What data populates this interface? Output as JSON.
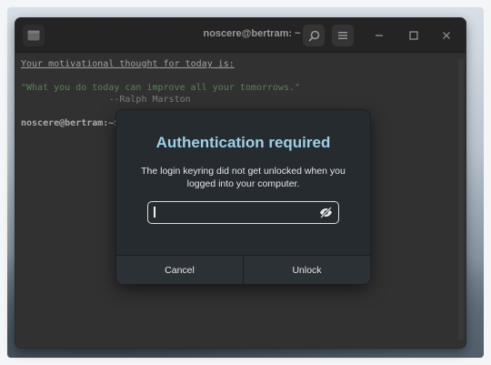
{
  "window": {
    "title": "noscere@bertram: ~",
    "icons": {
      "new_tab": "terminal-tab-icon",
      "search": "search-icon",
      "menu": "hamburger-menu-icon",
      "minimize": "minimize-icon",
      "maximize": "maximize-icon",
      "close": "close-icon"
    }
  },
  "terminal": {
    "line1": "Your motivational thought for today is:",
    "quote": "\"What you do today can improve all your tomorrows.\"",
    "author": "--Ralph Marston",
    "prompt": "noscere@bertram:~$"
  },
  "dialog": {
    "title": "Authentication required",
    "message": "The login keyring did not get unlocked when you logged into your computer.",
    "password_value": "",
    "visibility_icon": "eye-slash-icon",
    "cancel_label": "Cancel",
    "unlock_label": "Unlock"
  },
  "colors": {
    "dialog_title": "#9fd0e6",
    "dialog_bg": "#262b30",
    "terminal_bg": "#414141",
    "quote_text": "#7fa87a"
  }
}
